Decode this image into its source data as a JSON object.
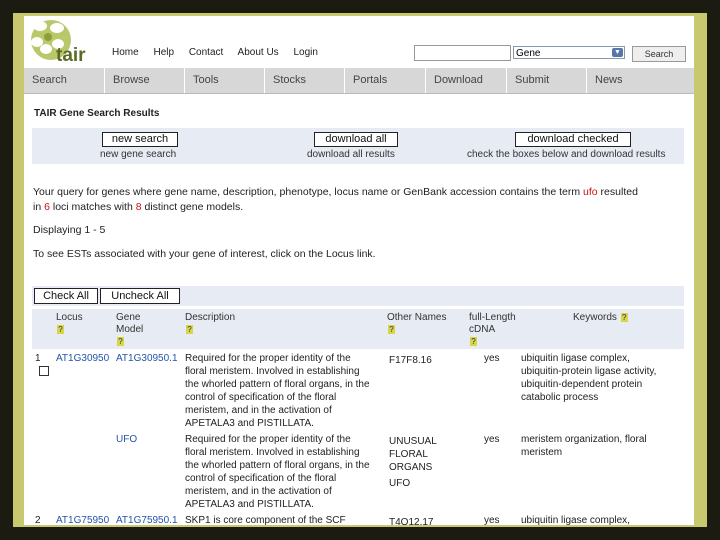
{
  "header": {
    "logo_text": "tair",
    "top_links": [
      "Home",
      "Help",
      "Contact",
      "About Us",
      "Login"
    ],
    "search_placeholder": "",
    "search_type": "Gene",
    "search_button": "Search"
  },
  "mainnav": [
    "Search",
    "Browse",
    "Tools",
    "Stocks",
    "Portals",
    "Download",
    "Submit",
    "News"
  ],
  "results": {
    "title": "TAIR Gene Search Results",
    "actions": [
      {
        "label": "new search",
        "caption": "new gene search"
      },
      {
        "label": "download all",
        "caption": "download all results"
      },
      {
        "label": "download checked",
        "caption": "check the boxes below and download results"
      }
    ],
    "query_line1_pre": "Your query for genes where gene name, description, phenotype, locus name or GenBank accession contains the term ",
    "query_term": "ufo",
    "query_line1_post": " resulted",
    "query_line2_pre": "in ",
    "locus_count": "6",
    "query_line2_mid": " loci matches with ",
    "model_count": "8",
    "query_line2_post": " distinct gene models.",
    "displaying": "Displaying 1 - 5",
    "est_note": "To see ESTs associated with your gene of interest, click on the Locus link.",
    "check_all": "Check All",
    "uncheck_all": "Uncheck All",
    "columns": {
      "locus": "Locus",
      "gene_model_1": "Gene",
      "gene_model_2": "Model",
      "description": "Description",
      "other_names": "Other Names",
      "full_length_1": "full-Length",
      "full_length_2": "cDNA",
      "keywords": "Keywords",
      "help": "?"
    },
    "rows": [
      {
        "num": "1",
        "locus": "AT1G30950",
        "model": "AT1G30950.1",
        "description": [
          "Required for the proper identity of the",
          "floral meristem. Involved in establishing",
          "the whorled pattern of floral organs, in the",
          "control of specification of the floral",
          "meristem, and in the activation of",
          "APETALA3 and PISTILLATA."
        ],
        "other_names": [
          "F17F8.16"
        ],
        "cdna": "yes",
        "keywords": [
          "ubiquitin ligase complex,",
          "ubiquitin-protein ligase activity,",
          "ubiquitin-dependent protein",
          "catabolic process"
        ]
      },
      {
        "num": "",
        "locus": "",
        "model": "UFO",
        "description": [
          "Required for the proper identity of the",
          "floral meristem. Involved in establishing",
          "the whorled pattern of floral organs, in the",
          "control of specification of the floral",
          "meristem, and in the activation of",
          "APETALA3 and PISTILLATA."
        ],
        "other_names": [
          "UNUSUAL",
          "FLORAL",
          "ORGANS",
          "",
          "UFO"
        ],
        "cdna": "yes",
        "keywords": [
          "meristem organization, floral",
          "meristem"
        ]
      },
      {
        "num": "2",
        "locus": "AT1G75950",
        "model": "AT1G75950.1",
        "description": [
          "SKP1 is core component of the SCF"
        ],
        "other_names": [
          "T4O12.17"
        ],
        "cdna": "yes",
        "keywords": [
          "ubiquitin ligase complex,"
        ]
      }
    ]
  }
}
